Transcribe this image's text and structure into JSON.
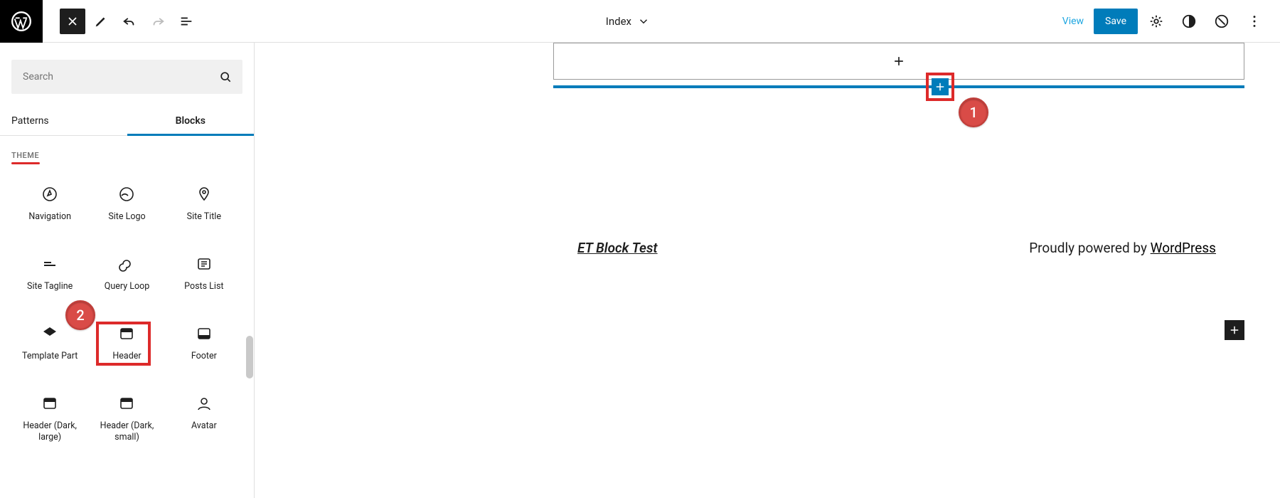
{
  "topbar": {
    "doc_title": "Index",
    "view_label": "View",
    "save_label": "Save"
  },
  "sidebar": {
    "search_placeholder": "Search",
    "tabs": {
      "patterns": "Patterns",
      "blocks": "Blocks"
    },
    "category": "THEME",
    "blocks": [
      {
        "label": "Navigation",
        "icon": "compass"
      },
      {
        "label": "Site Logo",
        "icon": "sitelogo"
      },
      {
        "label": "Site Title",
        "icon": "pin"
      },
      {
        "label": "Site Tagline",
        "icon": "tagline"
      },
      {
        "label": "Query Loop",
        "icon": "loop"
      },
      {
        "label": "Posts List",
        "icon": "postslist"
      },
      {
        "label": "Template Part",
        "icon": "templatepart"
      },
      {
        "label": "Header",
        "icon": "header"
      },
      {
        "label": "Footer",
        "icon": "footer"
      },
      {
        "label": "Header (Dark, large)",
        "icon": "header"
      },
      {
        "label": "Header (Dark, small)",
        "icon": "header"
      },
      {
        "label": "Avatar",
        "icon": "avatar"
      }
    ]
  },
  "canvas": {
    "site_title": "ET Block Test",
    "powered_prefix": "Proudly powered by ",
    "powered_link": "WordPress"
  },
  "annotations": {
    "badge1": "1",
    "badge2": "2"
  },
  "colors": {
    "accent": "#007cba",
    "annotation": "#dd2a2a"
  }
}
